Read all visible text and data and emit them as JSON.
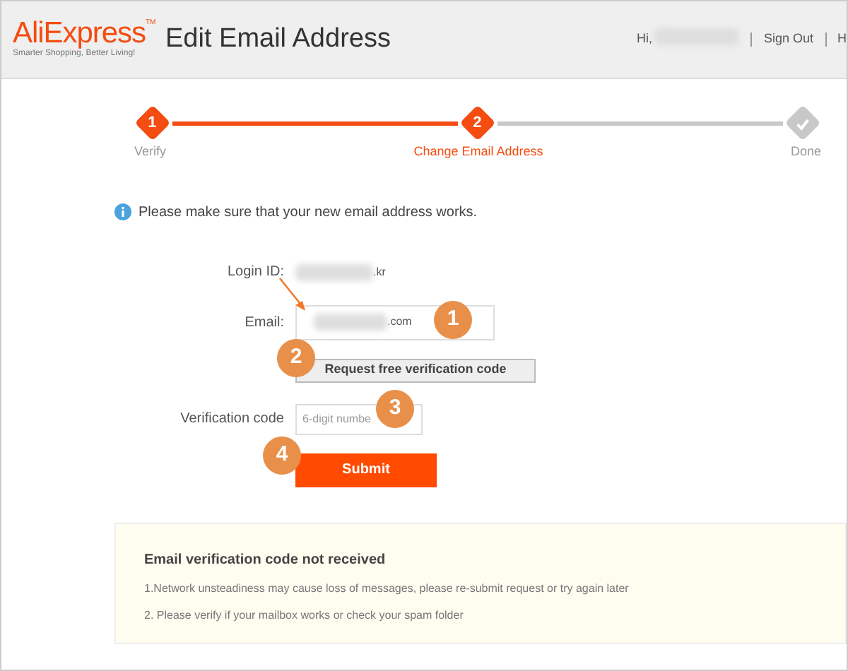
{
  "header": {
    "logo": {
      "name": "AliExpress",
      "tm": "TM",
      "tagline": "Smarter Shopping, Better Living!"
    },
    "title": "Edit Email Address",
    "greeting": "Hi,",
    "links": [
      "Sign Out",
      "H"
    ]
  },
  "steps": [
    {
      "number": "1",
      "label": "Verify",
      "completed": true,
      "selected": false
    },
    {
      "number": "2",
      "label": "Change Email Address",
      "completed": false,
      "selected": true
    },
    {
      "label": "Done",
      "completed": false,
      "selected": false
    }
  ],
  "info": "Please make sure that your new email address works.",
  "form": {
    "login_id": {
      "label": "Login ID:",
      "value": ".kr"
    },
    "email": {
      "label": "Email:",
      "value": ".com"
    },
    "request_button": "Request free verification code",
    "code": {
      "label": "Verification code",
      "placeholder": "6-digit numbe"
    },
    "submit": "Submit"
  },
  "callouts": [
    "1",
    "2",
    "3",
    "4"
  ],
  "notice": {
    "title": "Email verification code not received",
    "lines": [
      "1.Network unsteadiness may cause loss of messages, please re-submit request or try again later",
      "2. Please verify if your mailbox works or check your spam folder"
    ]
  }
}
